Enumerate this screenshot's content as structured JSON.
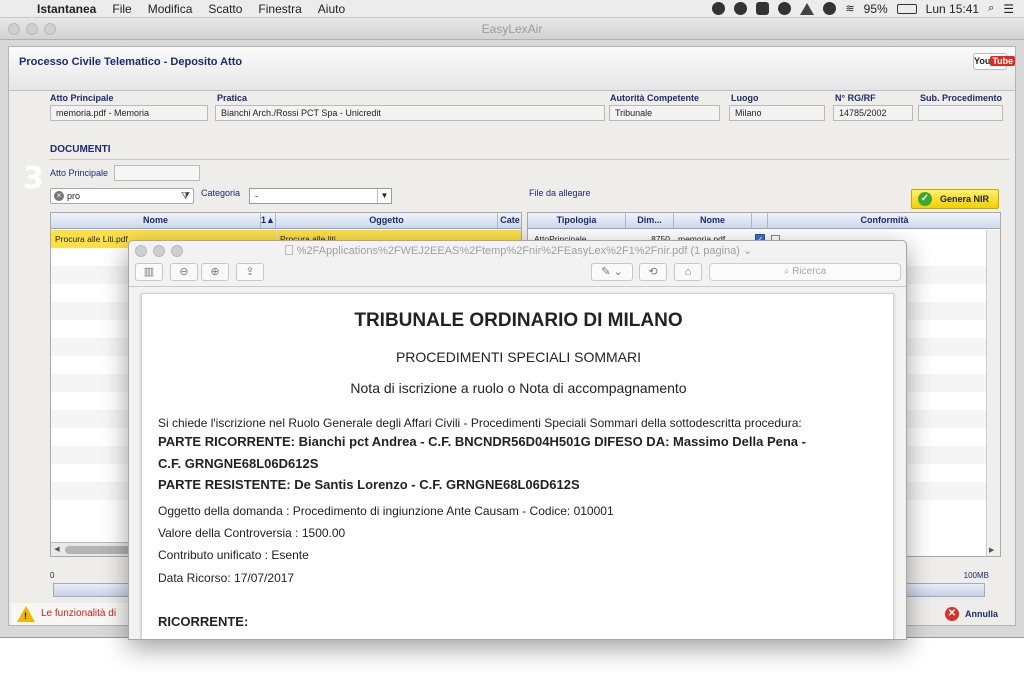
{
  "menubar": {
    "app_name": "Istantanea",
    "items": [
      "File",
      "Modifica",
      "Scatto",
      "Finestra",
      "Aiuto"
    ],
    "battery": "95%",
    "clock": "Lun 15:41"
  },
  "app_window": {
    "title": "EasyLexAir",
    "header_title": "Processo Civile Telematico - Deposito Atto",
    "youtube_label": "You",
    "youtube_tube": "Tube"
  },
  "fields": {
    "atto_principale": {
      "label": "Atto Principale",
      "value": "memoria.pdf - Memoria"
    },
    "pratica": {
      "label": "Pratica",
      "value": "Bianchi Arch./Rossi PCT Spa - Unicredit"
    },
    "autorita": {
      "label": "Autorità Competente",
      "value": "Tribunale"
    },
    "luogo": {
      "label": "Luogo",
      "value": "Milano"
    },
    "rg": {
      "label": "N° RG/RF",
      "value": "14785/2002"
    },
    "sub_procedimento": {
      "label": "Sub. Procedimento",
      "value": ""
    }
  },
  "documenti": {
    "title": "DOCUMENTI",
    "step": "3",
    "atto_principale_label": "Atto Principale",
    "search_value": "pro",
    "categoria_label": "Categoria",
    "categoria_value": "-",
    "file_da_allegare": "File da allegare",
    "genera_button": "Genera NIR"
  },
  "left_table": {
    "headers": [
      "Nome",
      "1",
      "Oggetto",
      "Cate"
    ],
    "rows": [
      {
        "nome": "Procura alle Liti.pdf",
        "oggetto": "Procura alle liti",
        "selected": true
      }
    ]
  },
  "right_table": {
    "headers": [
      "Tipologia",
      "Dim...",
      "Nome",
      "",
      "Conformità"
    ],
    "rows": [
      {
        "tipologia": "AttoPrincipale",
        "dim": "8750",
        "nome": "memoria.pdf",
        "checked": true
      }
    ]
  },
  "footer": {
    "progress_min": "0",
    "progress_max": "100MB",
    "warning_text": "Le funzionalità di",
    "annulla_button": "Annulla"
  },
  "preview": {
    "title": "%2FApplications%2FWEJ2EEAS%2Ftemp%2Fnir%2FEasyLex%2F1%2Fnir.pdf (1 pagina)",
    "search_placeholder": "Ricerca",
    "document": {
      "heading": "TRIBUNALE ORDINARIO DI MILANO",
      "subheading": "PROCEDIMENTI SPECIALI SOMMARI",
      "nota": "Nota di iscrizione a ruolo o Nota di accompagnamento",
      "intro": "Si chiede l'iscrizione nel Ruolo Generale degli Affari Civili - Procedimenti Speciali Sommari della sottodescritta procedura:",
      "ricorrente_line1": "PARTE RICORRENTE: Bianchi pct Andrea - C.F. BNCNDR56D04H501G DIFESO DA: Massimo Della Pena -",
      "ricorrente_line2": "C.F. GRNGNE68L06D612S",
      "resistente": "PARTE RESISTENTE: De Santis Lorenzo - C.F. GRNGNE68L06D612S",
      "oggetto": "Oggetto della domanda : Procedimento di ingiunzione Ante Causam - Codice: 010001",
      "valore": "Valore della Controversia : 1500.00",
      "contributo": "Contributo unificato :  Esente",
      "data_ricorso": "Data Ricorso: 17/07/2017",
      "ricorrente_section": "RICORRENTE:"
    }
  }
}
